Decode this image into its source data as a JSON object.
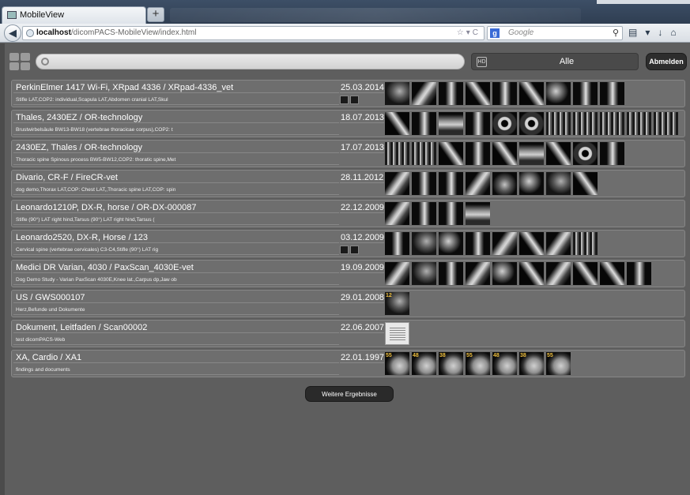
{
  "browser": {
    "tab_title": "MobileView",
    "new_tab": "+",
    "url_host": "localhost",
    "url_path": "/dicomPACS-MobileView/index.html",
    "search_engine_label": "Google",
    "search_engine_icon": "g-icon"
  },
  "header": {
    "search_placeholder": "",
    "filter_label": "Alle",
    "logout_label": "Abmelden"
  },
  "studies": [
    {
      "title": "PerkinElmer 1417 Wi-Fi, XRpad 4336 / XRpad-4336_vet",
      "description": "Stifle LAT,COP2: individual,Scapula LAT,Abdomen cranial LAT,Skul",
      "date": "25.03.2014",
      "mini_count": 2,
      "thumbs": [
        "t10",
        "t2",
        "t3",
        "t6",
        "t3",
        "t6",
        "t4",
        "t3",
        "t3"
      ]
    },
    {
      "title": "Thales, 2430EZ / OR-technology",
      "description": "Brustwirbelsäule BW13-BW18 (vertebrae thoracicae corpus),COP2: t",
      "date": "18.07.2013",
      "mini_count": 0,
      "thumbs": [
        "t6",
        "t3",
        "t8",
        "t3",
        "t7",
        "t7",
        "t5",
        "t5",
        "t5",
        "t5",
        "t5"
      ]
    },
    {
      "title": "2430EZ, Thales / OR-technology",
      "description": "Thoracic spine Spinous process BW5-BW12,COP2: thoratic spine,Met",
      "date": "17.07.2013",
      "mini_count": 0,
      "thumbs": [
        "t5",
        "t5",
        "t6",
        "t3",
        "t6",
        "t8",
        "t6",
        "t7",
        "t3"
      ]
    },
    {
      "title": "Divario, CR-F / FireCR-vet",
      "description": "dog demo,Thorax LAT,COP: Chest LAT,,Thoracic spine LAT,COP: spin",
      "date": "28.11.2012",
      "mini_count": 0,
      "thumbs": [
        "t2",
        "t3",
        "t3",
        "t2",
        "t1",
        "t4",
        "t10",
        "t6"
      ]
    },
    {
      "title": "Leonardo1210P, DX-R, horse / OR-DX-000087",
      "description": "Stifle (90°) LAT right hind,Tarsus (90°) LAT right hind,Tarsus (",
      "date": "22.12.2009",
      "mini_count": 0,
      "thumbs": [
        "t2",
        "t3",
        "t3",
        "t8"
      ]
    },
    {
      "title": "Leonardo2520, DX-R, Horse / 123",
      "description": "Cervical spine (vertebrae cervicales) C3-C4,Stifle (90°) LAT rig",
      "date": "03.12.2009",
      "mini_count": 2,
      "thumbs": [
        "t3",
        "t10",
        "t4",
        "t3",
        "t2",
        "t6",
        "t2",
        "t5"
      ]
    },
    {
      "title": "Medici DR Varian, 4030 / PaxScan_4030E-vet",
      "description": "Dog Demo Study - Varian PaxScan 4030E,Knee lat.,Carpus dp,Jaw ob",
      "date": "19.09.2009",
      "mini_count": 0,
      "thumbs": [
        "t2",
        "t10",
        "t3",
        "t2",
        "t4",
        "t6",
        "t2",
        "t6",
        "t6",
        "t3"
      ]
    },
    {
      "title": "US / GWS000107",
      "description": "Herz,Befunde und Dokumente",
      "date": "29.01.2008",
      "mini_count": 0,
      "thumbs": [
        "t10"
      ],
      "thumb_numbers": [
        "12"
      ]
    },
    {
      "title": "Dokument, Leitfaden / Scan00002",
      "description": "test dicomPACS-Web",
      "date": "22.06.2007",
      "mini_count": 0,
      "thumbs": [
        "t9"
      ]
    },
    {
      "title": "XA, Cardio / XA1",
      "description": "findings and documents",
      "date": "22.01.1997",
      "mini_count": 0,
      "thumbs": [
        "t11",
        "t11",
        "t11",
        "t11",
        "t11",
        "t11",
        "t11"
      ],
      "thumb_numbers": [
        "55",
        "48",
        "38",
        "55",
        "48",
        "38",
        "55"
      ]
    }
  ],
  "more_results_label": "Weitere Ergebnisse"
}
